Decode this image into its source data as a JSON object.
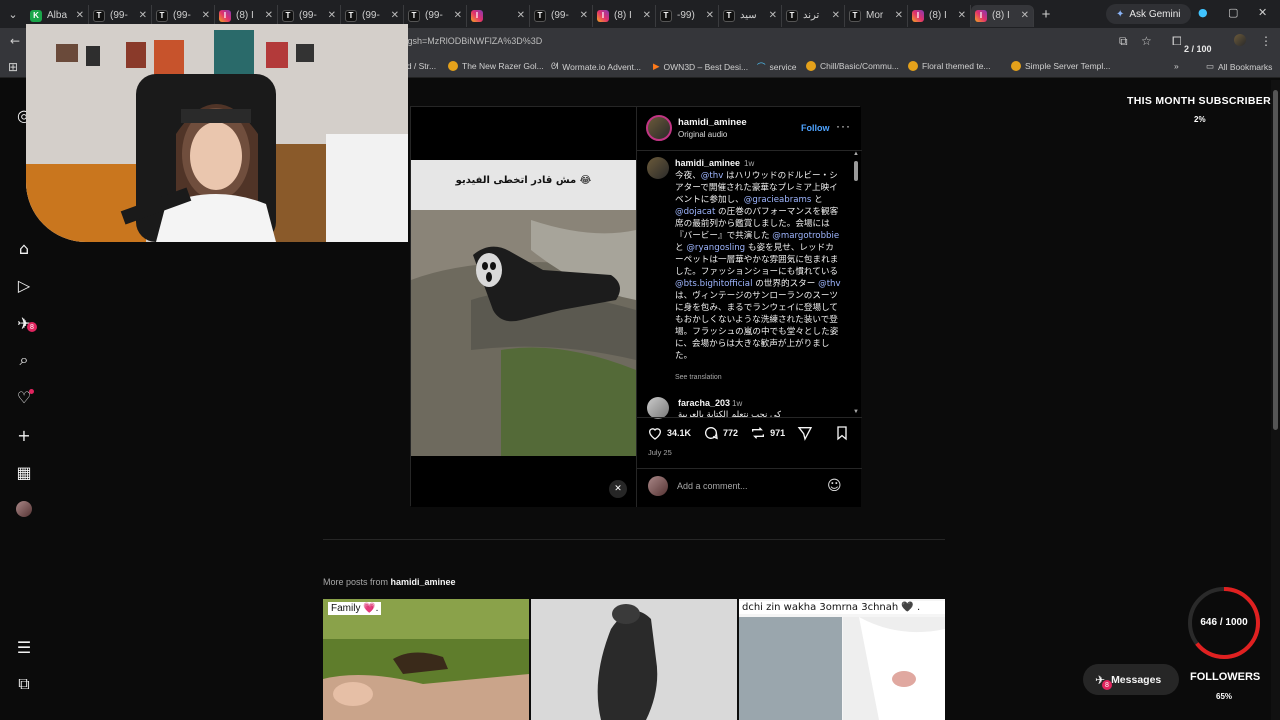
{
  "tabs": [
    {
      "favicon": "K",
      "title": "Alba",
      "type": "k"
    },
    {
      "favicon": "T",
      "title": "(99-",
      "type": "tt"
    },
    {
      "favicon": "T",
      "title": "(99-",
      "type": "tt"
    },
    {
      "favicon": "I",
      "title": "(8) I",
      "type": "ig"
    },
    {
      "favicon": "T",
      "title": "(99-",
      "type": "tt"
    },
    {
      "favicon": "T",
      "title": "(99-",
      "type": "tt"
    },
    {
      "favicon": "T",
      "title": "(99-",
      "type": "tt"
    },
    {
      "favicon": "I",
      "title": "",
      "type": "ig"
    },
    {
      "favicon": "T",
      "title": "(99-",
      "type": "tt"
    },
    {
      "favicon": "I",
      "title": "(8) I",
      "type": "ig"
    },
    {
      "favicon": "T",
      "title": "-99)",
      "type": "tt"
    },
    {
      "favicon": "T",
      "title": "سيد",
      "type": "tt"
    },
    {
      "favicon": "T",
      "title": "ترند",
      "type": "tt"
    },
    {
      "favicon": "T",
      "title": "Mor",
      "type": "tt"
    },
    {
      "favicon": "I",
      "title": "(8) I",
      "type": "ig"
    },
    {
      "favicon": "I",
      "title": "(8) I",
      "type": "ig",
      "active": true
    }
  ],
  "browser": {
    "ask_gemini": "Ask Gemini",
    "url": "k&igsh=MzRlODBiNWFlZA%3D%3D",
    "counter": "2 / 100"
  },
  "bookmarks": [
    "rd / Str...",
    "The New Razer Gol...",
    "Wormate.io Advent...",
    "OWN3D – Best Desi...",
    "service",
    "Chill/Basic/Commu...",
    "Floral themed te...",
    "Simple Server Templ...",
    "All Bookmarks"
  ],
  "post": {
    "author": "hamidi_aminee",
    "audio": "Original audio",
    "follow": "Follow",
    "video_overlay_text": "مش قادر اتخطى الفيديو 😂",
    "caption_time": "1w",
    "caption_parts": [
      {
        "t": "今夜、"
      },
      {
        "t": "@thv",
        "m": true
      },
      {
        "t": " はハリウッドのドルビー・シアターで開催された豪華なプレミア上映イベントに参加し、"
      },
      {
        "t": "@gracieabrams",
        "m": true
      },
      {
        "t": " と "
      },
      {
        "t": "@dojacat",
        "m": true
      },
      {
        "t": " の圧巻のパフォーマンスを観客席の最前列から鑑賞しました。会場には『バービー』で共演した "
      },
      {
        "t": "@margotrobbie",
        "m": true
      },
      {
        "t": " と "
      },
      {
        "t": "@ryangosling",
        "m": true
      },
      {
        "t": " も姿を見せ、レッドカーペットは一層華やかな雰囲気に包まれました。ファッションショーにも慣れている "
      },
      {
        "t": "@bts.bighitofficial",
        "m": true
      },
      {
        "t": " の世界的スター "
      },
      {
        "t": "@thv",
        "m": true
      },
      {
        "t": " は、ヴィンテージのサンローランのスーツに身を包み、まるでランウェイに登場してもおかしくないような洗練された装いで登場。フラッシュの嵐の中でも堂々とした姿に、会場からは大きな歓声が上がりました。"
      }
    ],
    "see_translation": "See translation",
    "comment2_author": "faracha_203",
    "comment2_time": "1w",
    "comment2_text": "كي نحب نتعلم الكتابة بالعربية",
    "likes": "34.1K",
    "comments": "772",
    "reposts": "971",
    "date": "July 25",
    "add_comment_placeholder": "Add a comment..."
  },
  "more_posts": {
    "prefix": "More posts from ",
    "author": "hamidi_aminee",
    "items": [
      {
        "caption": "Family 💗."
      },
      {
        "caption": ""
      },
      {
        "caption": "dchi zin wakha 3omrna 3chnah 🖤 ."
      }
    ]
  },
  "overlays": {
    "subs_title": "THIS MONTH SUBSCRIBERS",
    "subs_pct": "2%",
    "goal_text": "646 / 1000",
    "goal_fraction": 0.646,
    "messages": "Messages",
    "messages_badge": "8",
    "followers": "FOLLOWERS",
    "followers_pct": "65%"
  },
  "rail": {
    "notifications_badge": "8"
  }
}
